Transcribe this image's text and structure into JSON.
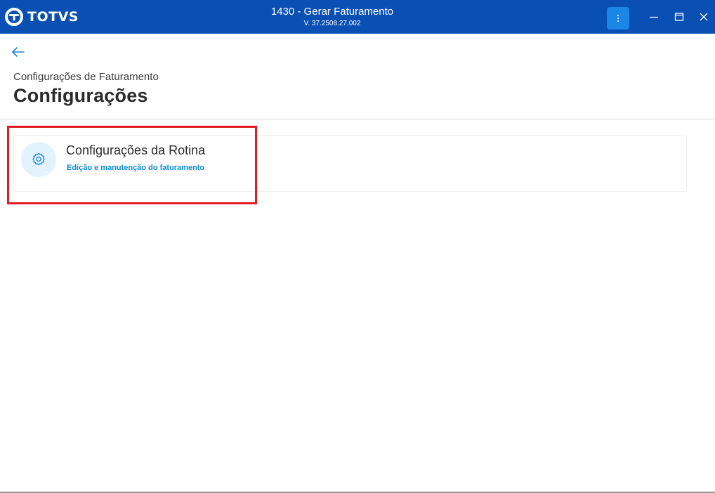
{
  "app": {
    "logo_text": "TOTVS",
    "title": "1430 - Gerar Faturamento",
    "version": "V. 37.2508.27.002"
  },
  "header": {
    "subtitle": "Configurações de Faturamento",
    "title": "Configurações"
  },
  "cards": [
    {
      "title": "Configurações da Rotina",
      "description": "Edição e manutenção do faturamento",
      "icon": "gear-icon"
    }
  ],
  "colors": {
    "titlebar": "#0a4fb3",
    "accent": "#0b8bd6",
    "highlight": "#e21b23",
    "icon_bg": "#e3f3fd"
  }
}
